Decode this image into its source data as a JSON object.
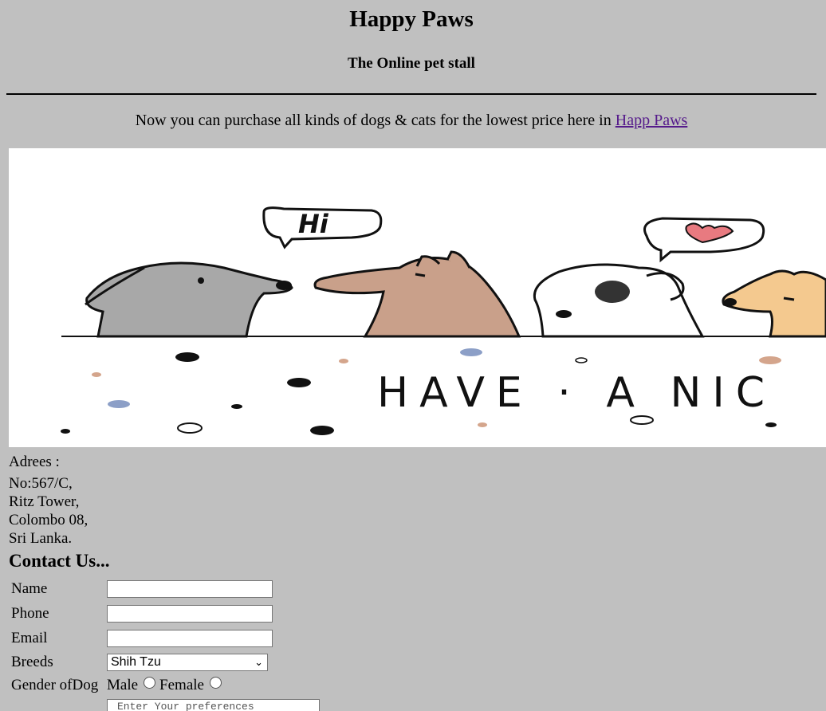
{
  "header": {
    "title": "Happy Paws",
    "subtitle": "The Online pet stall"
  },
  "intro": {
    "text": "Now you can purchase all kinds of dogs & cats for the lowest price here in ",
    "link_label": "Happ Paws"
  },
  "banner": {
    "speech_hi": "Hi",
    "slogan": "HAVE · A  NIC"
  },
  "address": {
    "label": "Adrees :",
    "lines": [
      "No:567/C,",
      "Ritz Tower,",
      "Colombo 08,",
      "Sri Lanka."
    ]
  },
  "contact": {
    "heading": "Contact Us...",
    "name_label": "Name",
    "phone_label": "Phone",
    "email_label": "Email",
    "breeds_label": "Breeds",
    "breeds_selected": "Shih Tzu",
    "gender_label": "Gender ofDog",
    "gender_male": "Male",
    "gender_female": "Female",
    "preferences_placeholder": "Enter Your preferences"
  },
  "colors": {
    "page_bg": "#c0c0c0",
    "link": "#551a8b"
  }
}
